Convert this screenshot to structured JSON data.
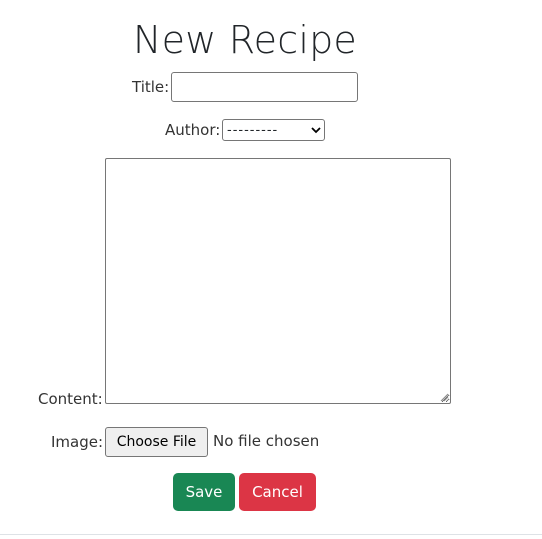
{
  "heading": "New Recipe",
  "form": {
    "title": {
      "label": "Title:",
      "value": ""
    },
    "author": {
      "label": "Author:",
      "selected": "---------"
    },
    "content": {
      "label": "Content:",
      "value": ""
    },
    "image": {
      "label": "Image:",
      "button_label": "Choose File",
      "status": "No file chosen"
    }
  },
  "actions": {
    "save_label": "Save",
    "cancel_label": "Cancel"
  },
  "colors": {
    "save": "#198754",
    "cancel": "#dc3545"
  },
  "icons": {
    "select_arrow": "chevron-down-icon",
    "textarea_resize": "resize-grip-icon"
  }
}
